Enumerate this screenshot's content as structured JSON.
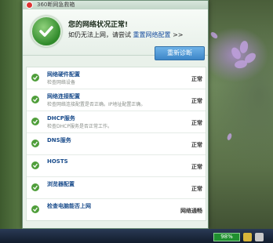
{
  "window": {
    "title": "360断网急救箱"
  },
  "status": {
    "title": "您的网络状况正常!",
    "sub_prefix": "如仍无法上网，请尝试",
    "sub_link": "重置网络配置",
    "sub_suffix": ">>"
  },
  "rediag_button": "重新诊断",
  "items": [
    {
      "name": "网络硬件配置",
      "desc": "检查网络设备",
      "status": "正常"
    },
    {
      "name": "网络连接配置",
      "desc": "检查网络连接配置是否正确。IP地址配置正确。",
      "status": "正常"
    },
    {
      "name": "DHCP服务",
      "desc": "检查DHCP服务是否正常工作。",
      "status": "正常"
    },
    {
      "name": "DNS服务",
      "desc": "",
      "status": "正常"
    },
    {
      "name": "HOSTS",
      "desc": "",
      "status": "正常"
    },
    {
      "name": "浏览器配置",
      "desc": "",
      "status": "正常"
    },
    {
      "name": "检查电脑能否上网",
      "desc": "",
      "status": "网络通畅"
    }
  ],
  "taskbar": {
    "battery_label": "98%",
    "battery_level": 0.98
  },
  "colors": {
    "accent": "#3d86c8",
    "ok_green": "#4f9e3a",
    "link_blue": "#1a4fa0"
  }
}
